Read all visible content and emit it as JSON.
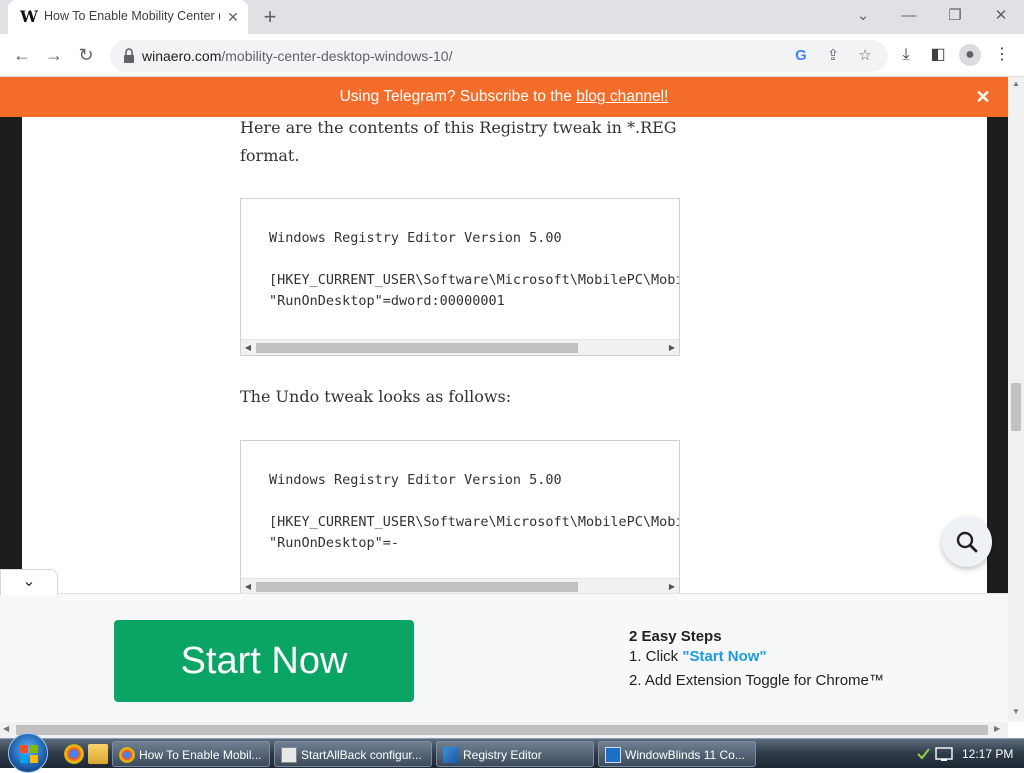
{
  "browser": {
    "tab_title": "How To Enable Mobility Center (",
    "tab_favicon_text": "W",
    "url_domain": "winaero.com",
    "url_path": "/mobility-center-desktop-windows-10/"
  },
  "banner": {
    "text_before": "Using Telegram? Subscribe to the ",
    "link_text": "blog channel!",
    "color": "#f36c2a"
  },
  "article": {
    "intro": "Here are the contents of this Registry tweak in *.REG format.",
    "code1": {
      "line1": "Windows Registry Editor Version 5.00",
      "line2": "[HKEY_CURRENT_USER\\Software\\Microsoft\\MobilePC\\Mobi",
      "line3": "\"RunOnDesktop\"=dword:00000001"
    },
    "undo_text": "The Undo tweak looks as follows:",
    "code2": {
      "line1": "Windows Registry Editor Version 5.00",
      "line2": "[HKEY_CURRENT_USER\\Software\\Microsoft\\MobilePC\\Mobi",
      "line3": "\"RunOnDesktop\"=-"
    }
  },
  "ad": {
    "button_label": "Start Now",
    "steps_title": "2 Easy Steps",
    "step1_prefix": "1. Click ",
    "step1_highlight": "\"Start Now\"",
    "step2": "2. Add Extension Toggle for Chrome™",
    "button_color": "#0aa565"
  },
  "taskbar": {
    "tasks": [
      {
        "label": "How To Enable Mobil..."
      },
      {
        "label": "StartAllBack configur..."
      },
      {
        "label": "Registry Editor"
      },
      {
        "label": "WindowBlinds 11 Co..."
      }
    ],
    "clock": "12:17 PM"
  }
}
